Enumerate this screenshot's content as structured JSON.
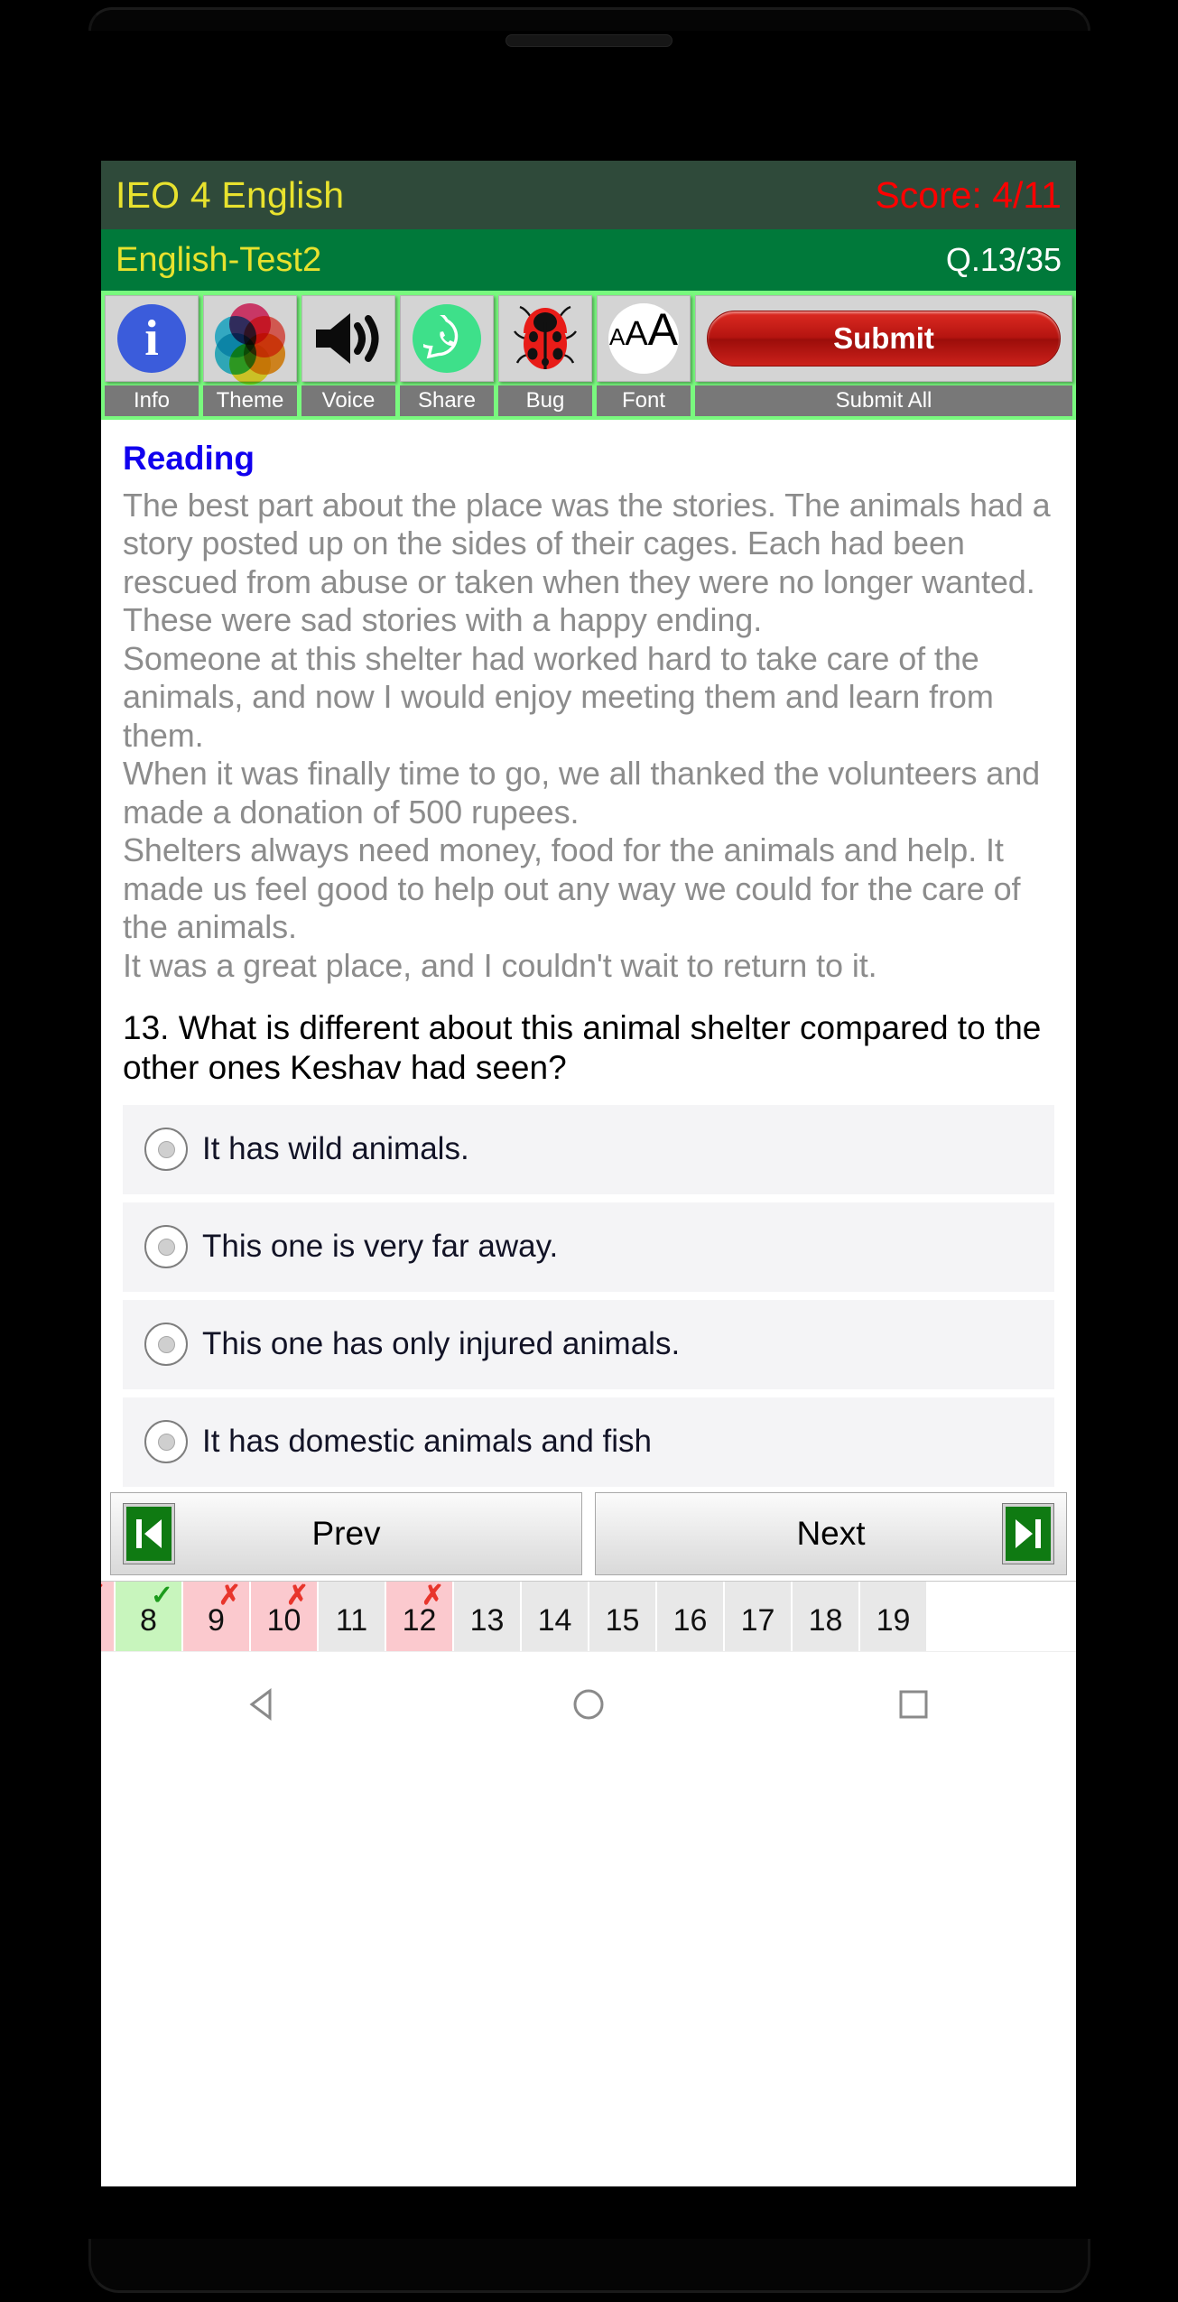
{
  "header": {
    "app_title": "IEO 4 English",
    "score": "Score: 4/11",
    "test_name": "English-Test2",
    "question_counter": "Q.13/35",
    "colors": {
      "title_bg": "#2f4a3a",
      "sub_bg": "#00793a",
      "title_text": "#e8e22e",
      "score_text": "#ff0000"
    }
  },
  "toolbar": {
    "items": [
      {
        "icon": "info-icon",
        "label": "Info"
      },
      {
        "icon": "theme-palette-icon",
        "label": "Theme"
      },
      {
        "icon": "speaker-icon",
        "label": "Voice"
      },
      {
        "icon": "whatsapp-share-icon",
        "label": "Share"
      },
      {
        "icon": "ladybug-icon",
        "label": "Bug"
      },
      {
        "icon": "font-size-icon",
        "label": "Font"
      }
    ],
    "submit_button_label": "Submit",
    "submit_all_label": "Submit All",
    "font_icon_text": {
      "small": "A",
      "medium": "A",
      "large": "A"
    }
  },
  "content": {
    "reading_heading": "Reading",
    "passage": "The best part about the place was the stories. The animals had a story posted up on the sides of their cages. Each had been rescued from abuse or taken when they were no longer wanted.\nThese were sad stories with a happy ending.\nSomeone at this shelter had worked hard to take care of the animals, and now I would enjoy meeting them and learn from them.\nWhen it was finally time to go, we all thanked the volunteers and made a donation of 500 rupees.\nShelters always need money, food for the animals and help. It made us feel good to help out any way we could for the care of the animals.\nIt was a great place, and I couldn't wait to return to it.",
    "question": "13. What is different about this animal shelter compared to the other ones Keshav had seen?",
    "options": [
      {
        "label": "It has wild animals.",
        "selected": false
      },
      {
        "label": "This one is very far away.",
        "selected": false
      },
      {
        "label": "This one has only injured animals.",
        "selected": false
      },
      {
        "label": "It has domestic animals and fish",
        "selected": false
      }
    ]
  },
  "navigation": {
    "prev_label": "Prev",
    "next_label": "Next",
    "prev_icon": "skip-previous-icon",
    "next_icon": "skip-next-icon"
  },
  "question_strip": [
    {
      "number": "",
      "state": "pink",
      "mark": "cross",
      "partial": true
    },
    {
      "number": "8",
      "state": "green",
      "mark": "tick"
    },
    {
      "number": "9",
      "state": "pink",
      "mark": "cross"
    },
    {
      "number": "10",
      "state": "pink",
      "mark": "cross"
    },
    {
      "number": "11",
      "state": "gray",
      "mark": ""
    },
    {
      "number": "12",
      "state": "pink",
      "mark": "cross"
    },
    {
      "number": "13",
      "state": "gray",
      "mark": ""
    },
    {
      "number": "14",
      "state": "gray",
      "mark": ""
    },
    {
      "number": "15",
      "state": "gray",
      "mark": ""
    },
    {
      "number": "16",
      "state": "gray",
      "mark": ""
    },
    {
      "number": "17",
      "state": "gray",
      "mark": ""
    },
    {
      "number": "18",
      "state": "gray",
      "mark": ""
    },
    {
      "number": "19",
      "state": "gray",
      "mark": ""
    }
  ],
  "system_nav": {
    "back_icon": "triangle-back-icon",
    "home_icon": "circle-home-icon",
    "recents_icon": "square-recents-icon"
  }
}
